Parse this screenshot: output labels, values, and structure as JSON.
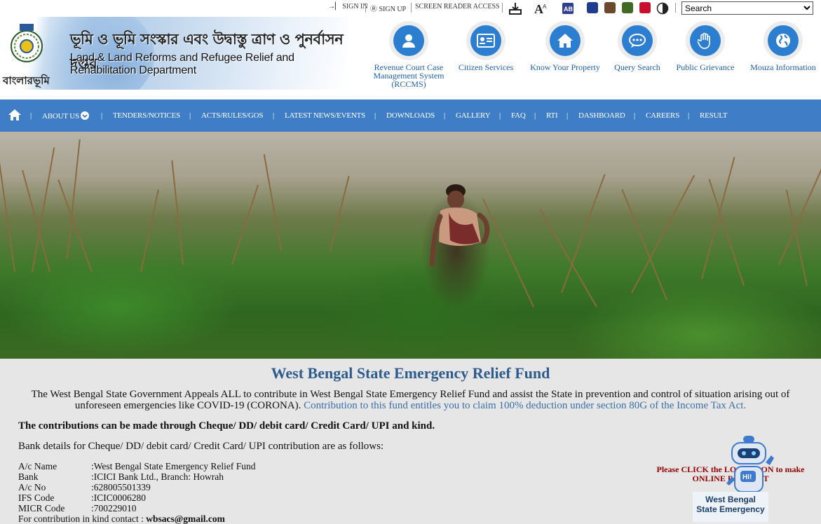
{
  "topbar": {
    "sign_in": "SIGN IN",
    "sign_up": "SIGN UP",
    "screen_reader": "SCREEN READER ACCESS",
    "search_value": "Search",
    "theme_colors": [
      "#1f3c8f",
      "#6b4a2b",
      "#3f6b22",
      "#c8102e"
    ]
  },
  "header": {
    "logo_text": "বাংলারভূমি",
    "dept_bengali": "ভূমি ও ভূমি সংস্কার এবং উদ্বাস্তু ত্রাণ ও পুনর্বাসন দপ্তর",
    "dept_english": "Land & Land Reforms and Refugee Relief and Rehabilitation Department",
    "services": [
      {
        "icon": "user-icon",
        "label": "Revenue Court Case Management System (RCCMS)"
      },
      {
        "icon": "id-card-icon",
        "label": "Citizen Services"
      },
      {
        "icon": "home-icon",
        "label": "Know Your Property"
      },
      {
        "icon": "chat-icon",
        "label": "Query Search"
      },
      {
        "icon": "hand-icon",
        "label": "Public Grievance"
      },
      {
        "icon": "globe-icon",
        "label": "Mouza Information"
      }
    ]
  },
  "nav": {
    "items": [
      "ABOUT US",
      "TENDERS/NOTICES",
      "ACTS/RULES/GOS",
      "LATEST NEWS/EVENTS",
      "DOWNLOADS",
      "GALLERY",
      "FAQ",
      "RTI",
      "DASHBOARD",
      "CAREERS",
      "RESULT"
    ]
  },
  "content": {
    "title": "West Bengal State Emergency Relief Fund",
    "appeal": "The West Bengal State Government Appeals ALL to contribute in West Bengal State Emergency Relief Fund and assist the State in prevention and control of situation arising out of unforeseen emergencies like COVID-19 (CORONA).",
    "deduction": "Contribution to this fund entitles you to claim 100% deduction under section 80G of the Income Tax Act.",
    "modes": "The contributions can be made through Cheque/ DD/ debit card/ Credit Card/ UPI and kind.",
    "bank_intro": "Bank details for Cheque/ DD/ debit card/ Credit Card/ UPI contribution are as follows:",
    "bank_details": [
      {
        "key": "A/c Name",
        "value": ":West Bengal State Emergency Relief Fund"
      },
      {
        "key": "Bank",
        "value": ":ICICI Bank Ltd., Branch: Howrah"
      },
      {
        "key": "A/c No",
        "value": ":628005501339"
      },
      {
        "key": "IFS Code",
        "value": ":ICIC0006280"
      },
      {
        "key": "MICR Code",
        "value": ":700229010"
      }
    ],
    "kind_contact_label": "For contribution in kind contact :",
    "kind_contact_email": "wbsacs@gmail.com",
    "click_text": "Please CLICK the LOGO/ICON to make ONLINE PAYMENT",
    "bot_label_1": "West Bengal",
    "bot_label_2": "State Emergency"
  }
}
